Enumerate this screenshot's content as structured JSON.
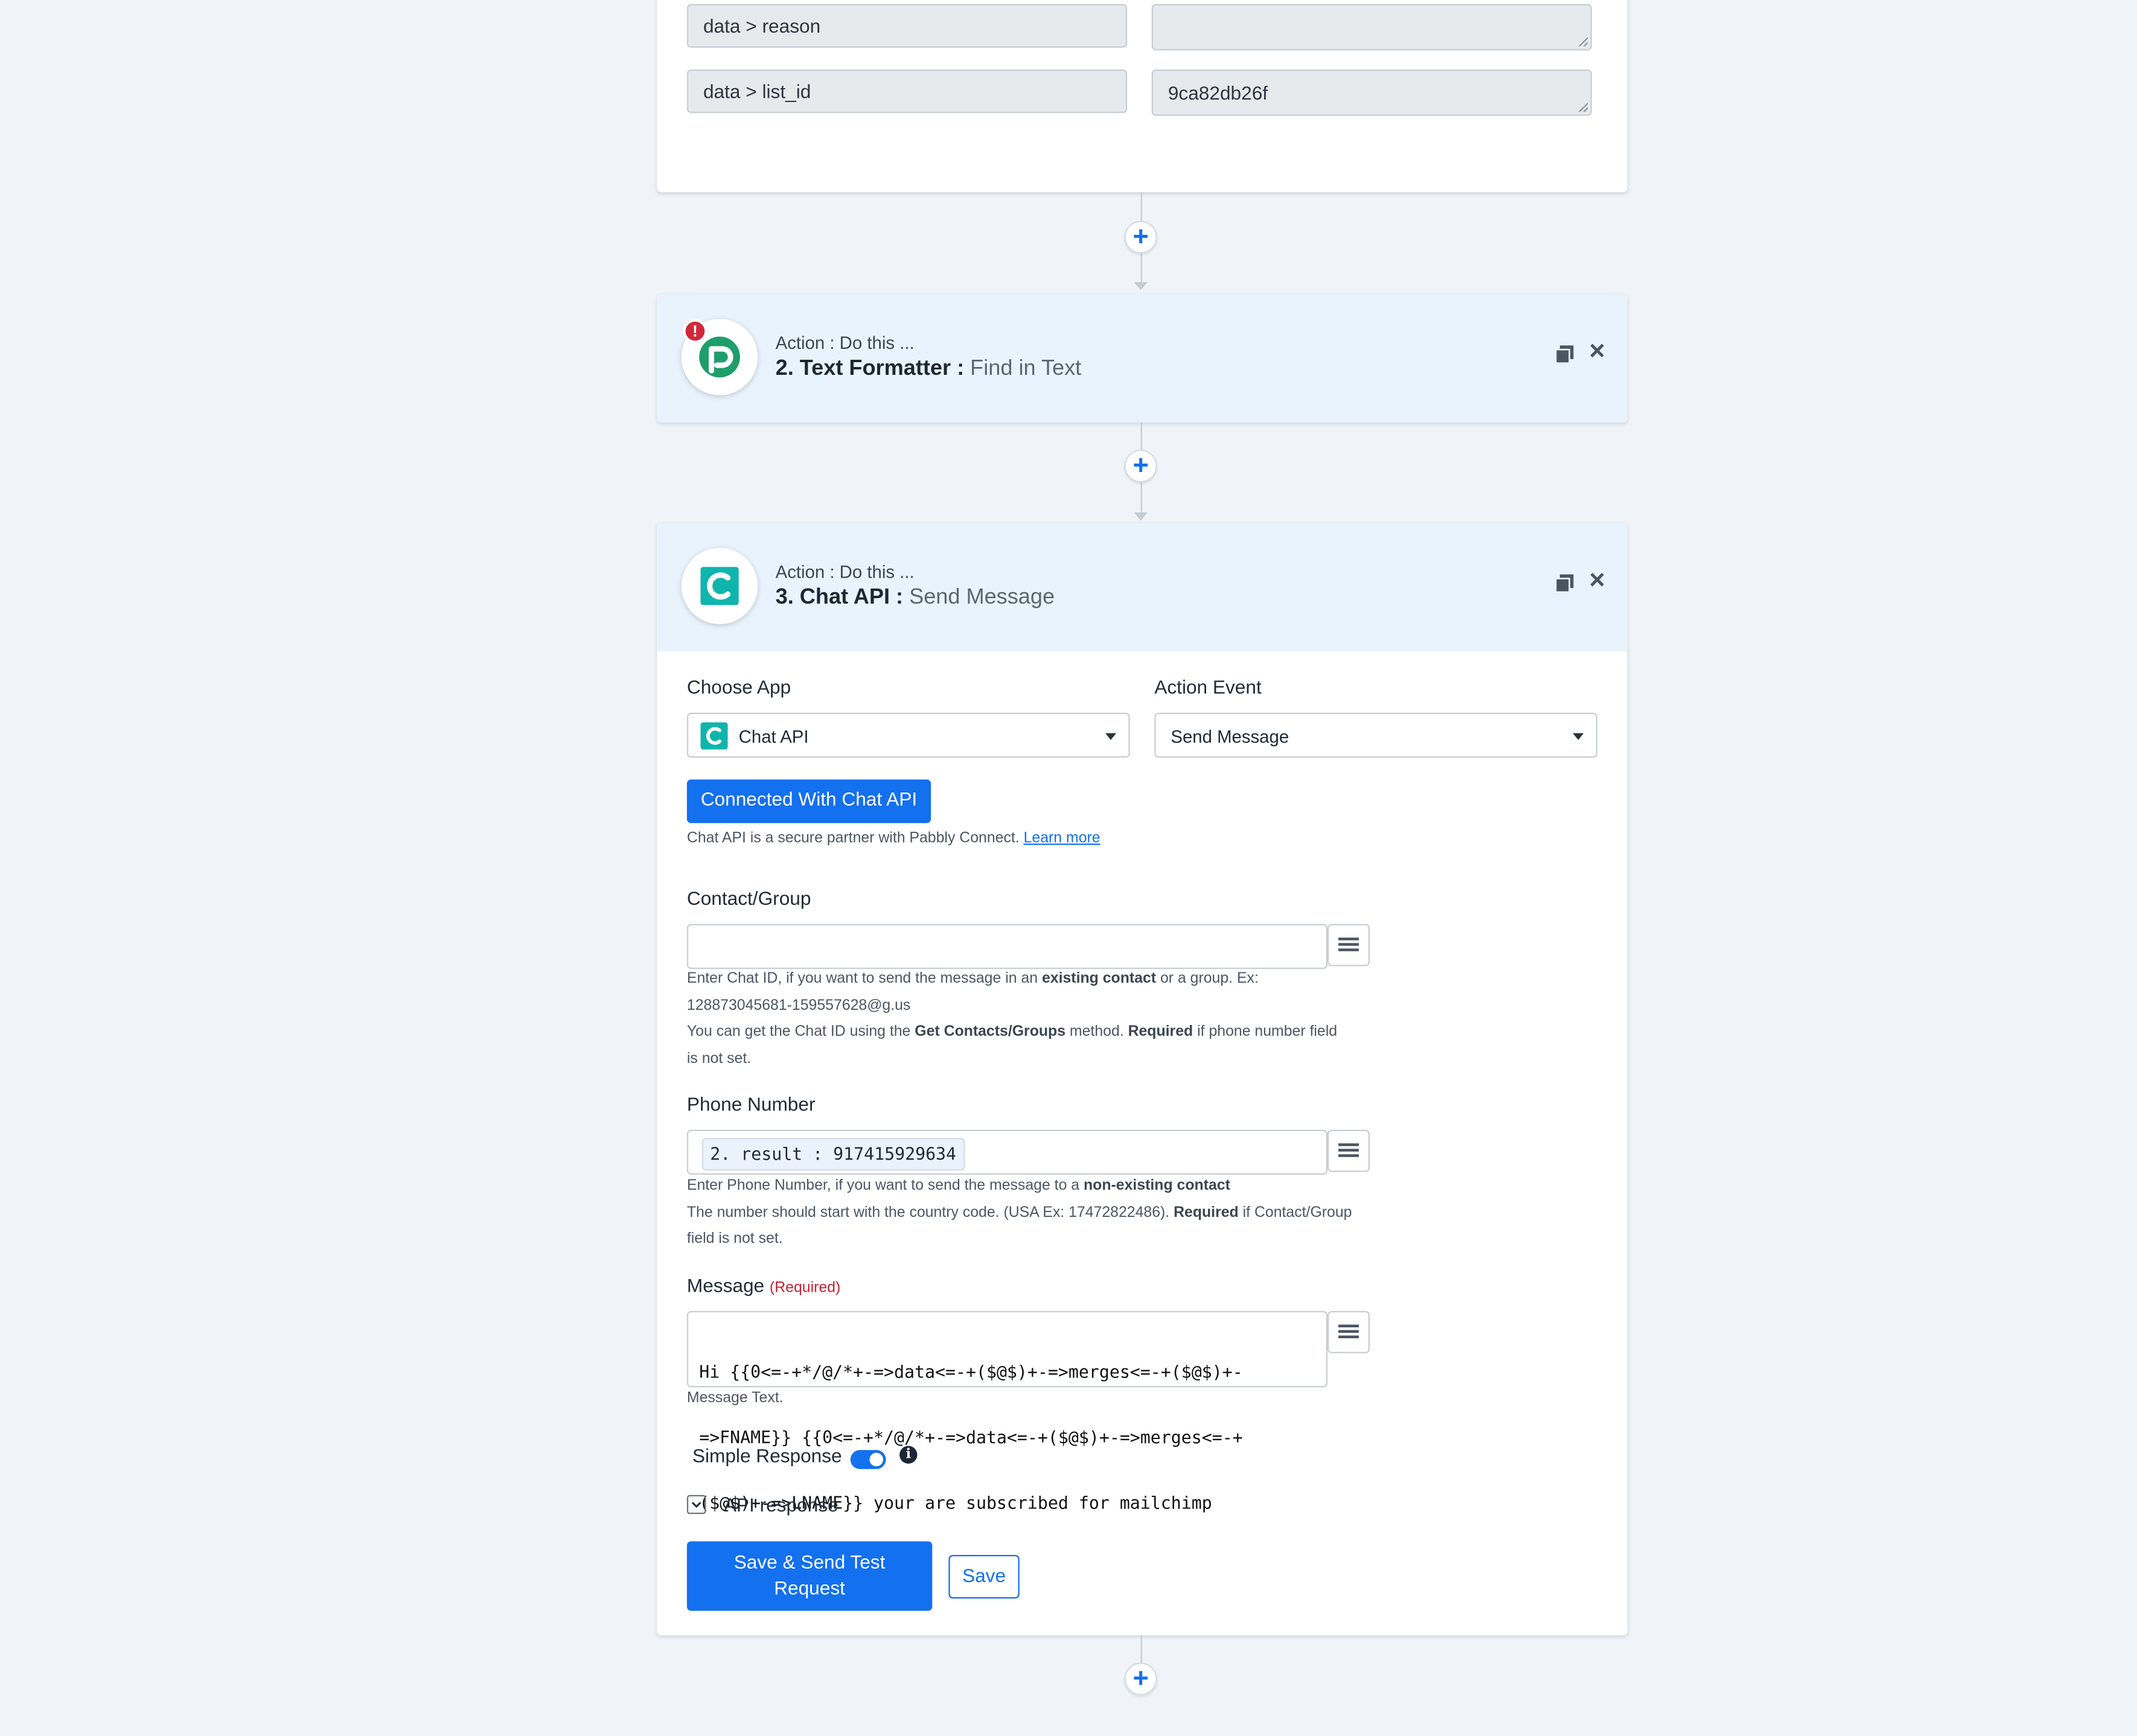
{
  "mapping_rows": [
    {
      "key": "data > reason",
      "value": ""
    },
    {
      "key": "data > list_id",
      "value": "9ca82db26f"
    }
  ],
  "step2": {
    "subtitle": "Action : Do this ...",
    "title": "2. Text Formatter :",
    "event": "Find in Text",
    "logo_letter": "p",
    "error_badge": "!"
  },
  "step3": {
    "subtitle": "Action : Do this ...",
    "title": "3. Chat API :",
    "event": "Send Message",
    "logo_letter": "C",
    "choose_app_label": "Choose App",
    "choose_app_value": "Chat API",
    "action_event_label": "Action Event",
    "action_event_value": "Send Message",
    "connected_button": "Connected With Chat API",
    "partner_text": "Chat API is a secure partner with Pabbly Connect.",
    "learn_more": "Learn more",
    "contact_label": "Contact/Group",
    "contact_value": "",
    "contact_help": {
      "l1a": "Enter Chat ID, if you want to send the message in an ",
      "l1b": "existing contact",
      "l1c": " or a group. Ex:",
      "l2": "128873045681-159557628@g.us",
      "l3a": "You can get the Chat ID using the ",
      "l3b": "Get Contacts/Groups",
      "l3c": " method. ",
      "l3d": "Required",
      "l3e": " if phone number field",
      "l4": "is not set."
    },
    "phone_label": "Phone Number",
    "phone_chip": "2. result : 917415929634",
    "phone_help": {
      "l1a": "Enter Phone Number, if you want to send the message to a ",
      "l1b": "non-existing contact",
      "l2a": "The number should start with the country code. (USA Ex: 17472822486). ",
      "l2b": "Required",
      "l2c": " if Contact/Group",
      "l3": "field is not set."
    },
    "message_label": "Message",
    "message_required": "(Required)",
    "message_lines": [
      "Hi {{0<=-+*/@/*+-=>data<=-+($@$)+-=>merges<=-+($@$)+-",
      "=>FNAME}} {{0<=-+*/@/*+-=>data<=-+($@$)+-=>merges<=-+",
      "($@$)+-=>LNAME}} your are subscribed for mailchimp"
    ],
    "message_help": "Message Text.",
    "simple_response_label": "Simple Response",
    "simple_response_on": true,
    "info_glyph": "i",
    "api_response_label": "API response",
    "save_send_line1": "Save & Send Test",
    "save_send_line2": "Request",
    "save_label": "Save"
  },
  "icons": {
    "add": "+",
    "copy": "copy-icon",
    "close": "×",
    "menu": "hamburger-menu-icon",
    "chevron": "chevron-down-icon"
  },
  "colors": {
    "accent": "#1370ef",
    "header_bg": "#e8f3fd",
    "page_bg": "#f0f4f8",
    "error": "#d0283a",
    "pabbly_green": "#1e9e6a",
    "chatapi_teal": "#0fb5ad",
    "required": "#c81e32"
  }
}
